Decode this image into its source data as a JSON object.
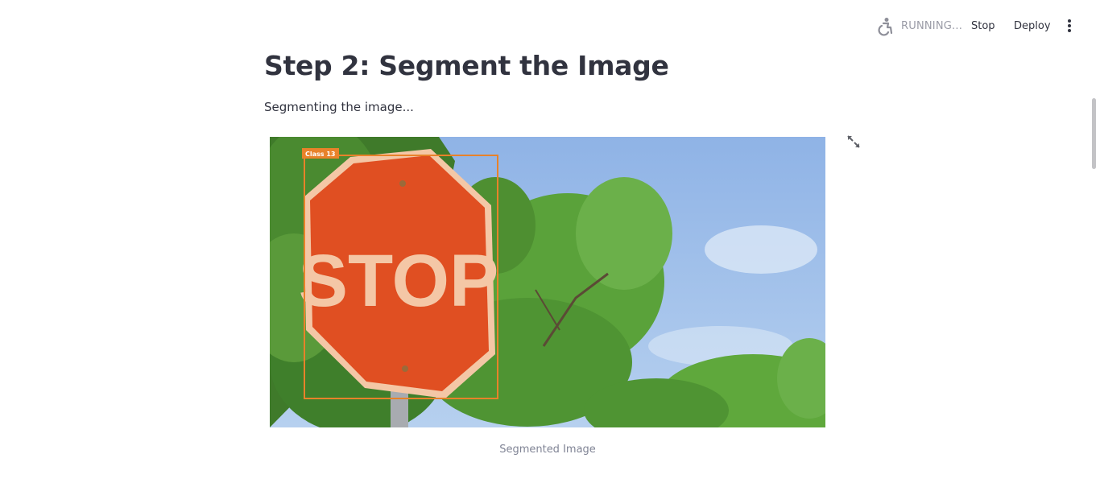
{
  "toolbar": {
    "status_icon": "running-person-icon",
    "status": "RUNNING...",
    "stop_label": "Stop",
    "deploy_label": "Deploy",
    "menu_icon": "vertical-ellipsis-icon"
  },
  "main": {
    "title": "Step 2: Segment the Image",
    "status_text": "Segmenting the image...",
    "image": {
      "detection_label": "Class 13",
      "sign_text": "STOP",
      "box_color": "#e8822a",
      "caption": "Segmented Image",
      "fullscreen_icon": "expand-arrows-icon"
    }
  }
}
